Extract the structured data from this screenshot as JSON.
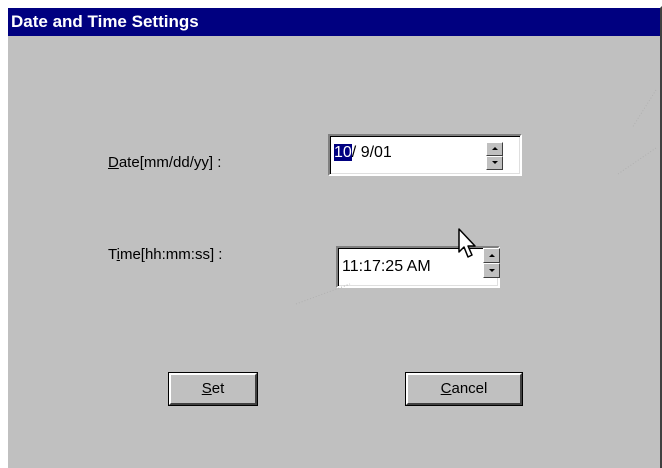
{
  "window": {
    "title": "Date and Time Settings"
  },
  "date_field": {
    "label_mnemonic": "D",
    "label_rest": "ate[mm/dd/yy] :",
    "value_selected": "10",
    "value_rest": "/  9/01"
  },
  "time_field": {
    "label_prefix": "T",
    "label_mnemonic": "i",
    "label_rest": "me[hh:mm:ss] :",
    "value": "11:17:25 AM"
  },
  "buttons": {
    "set_mnemonic": "S",
    "set_rest": "et",
    "cancel_mnemonic": "C",
    "cancel_rest": "ancel"
  },
  "icons": {
    "spin_up": "arrow-up-icon",
    "spin_down": "arrow-down-icon",
    "pointer": "mouse-pointer-icon"
  },
  "colors": {
    "titlebar": "#000080",
    "face": "#c0c0c0",
    "selection": "#000080"
  }
}
